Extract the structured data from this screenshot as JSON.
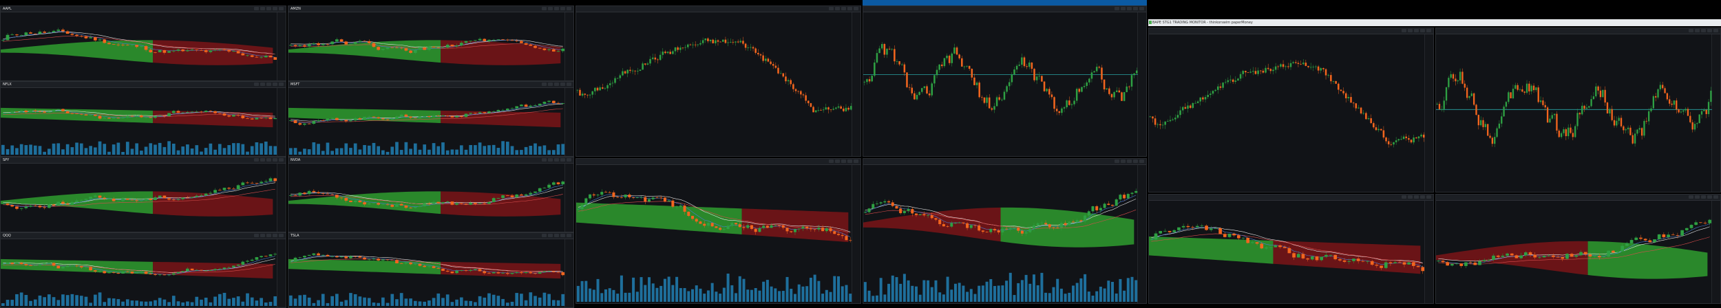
{
  "window_title": "BAPE STG1 TRADING MONITOR - thinkorswim paperMoney",
  "colors": {
    "background": "#111317",
    "bull": "#2ea043",
    "bear": "#f2651e",
    "cloud_bull": "#2f9d2f",
    "cloud_bear": "#7a1518",
    "volume": "#1e6f9c",
    "ma_white": "#e6e6e6"
  },
  "icons": [
    "gear-icon",
    "chart-style-icon",
    "drawing-icon",
    "studies-icon",
    "share-icon"
  ],
  "panels": [
    {
      "symbol": "AAPL",
      "col": 0,
      "row": 0
    },
    {
      "symbol": "NFLX",
      "col": 1,
      "row": 0
    },
    {
      "symbol": "SPY",
      "col": 0,
      "row": 1
    },
    {
      "symbol": "QQQ",
      "col": 1,
      "row": 1
    },
    {
      "symbol": "AMZN",
      "col": 0,
      "row": 2
    },
    {
      "symbol": "MSFT",
      "col": 1,
      "row": 2
    },
    {
      "symbol": "NVDA",
      "col": 0,
      "row": 3
    },
    {
      "symbol": "TSLA",
      "col": 1,
      "row": 3
    }
  ]
}
